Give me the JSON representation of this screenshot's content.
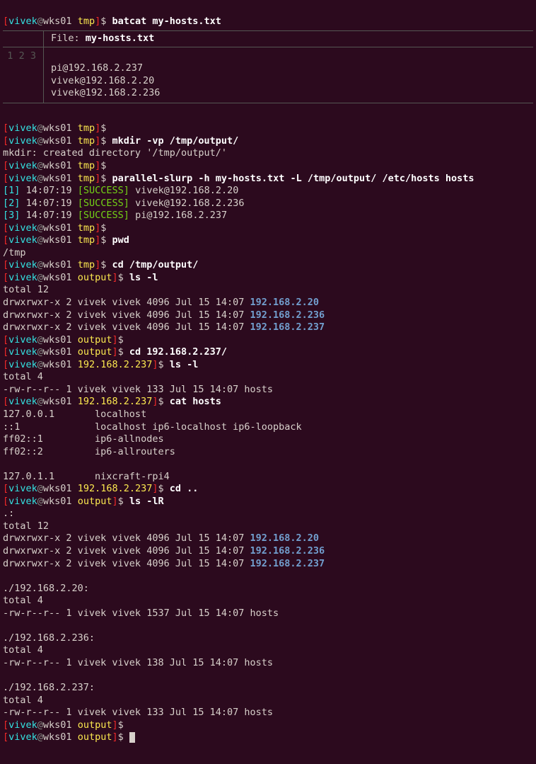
{
  "prompt": {
    "user": "vivek",
    "host": "wks01",
    "tmp": "tmp",
    "output": "output",
    "ip237": "192.168.2.237"
  },
  "cmd": {
    "batcat": "batcat my-hosts.txt",
    "mkdir": "mkdir -vp /tmp/output/",
    "pslurp": "parallel-slurp -h my-hosts.txt -L /tmp/output/ /etc/hosts hosts",
    "pwd": "pwd",
    "cdoutput": "cd /tmp/output/",
    "lsl": "ls -l",
    "cd237": "cd 192.168.2.237/",
    "cathosts": "cat hosts",
    "cdup": "cd ..",
    "lslr": "ls -lR"
  },
  "bat": {
    "file_label": "File:",
    "file_name": "my-hosts.txt",
    "ln1": "1",
    "ln2": "2",
    "ln3": "3",
    "l1": "pi@192.168.2.237",
    "l2": "vivek@192.168.2.20",
    "l3": "vivek@192.168.2.236"
  },
  "out": {
    "mkdir": "mkdir: created directory '/tmp/output/'",
    "pwd": "/tmp",
    "total12": "total 12",
    "total4": "total 4",
    "dotcolon": ".:",
    "dir20": "./192.168.2.20:",
    "dir236": "./192.168.2.236:",
    "dir237": "./192.168.2.237:"
  },
  "pssh": {
    "n1": "1",
    "n2": "2",
    "n3": "3",
    "t1": "14:07:19",
    "t2": "14:07:19",
    "t3": "14:07:19",
    "success": "SUCCESS",
    "h1": "vivek@192.168.2.20",
    "h2": "vivek@192.168.2.236",
    "h3": "pi@192.168.2.237"
  },
  "ls": {
    "row_prefix": "drwxrwxr-x 2 vivek vivek 4096 Jul 15 14:07 ",
    "ip20": "192.168.2.20",
    "ip236": "192.168.2.236",
    "ip237": "192.168.2.237",
    "hosts133": "-rw-r--r-- 1 vivek vivek 133 Jul 15 14:07 hosts",
    "hosts1537": "-rw-r--r-- 1 vivek vivek 1537 Jul 15 14:07 hosts",
    "hosts138": "-rw-r--r-- 1 vivek vivek 138 Jul 15 14:07 hosts"
  },
  "hosts": {
    "l1": "127.0.0.1       localhost",
    "l2": "::1             localhost ip6-localhost ip6-loopback",
    "l3": "ff02::1         ip6-allnodes",
    "l4": "ff02::2         ip6-allrouters",
    "l5": "127.0.1.1       nixcraft-rpi4"
  },
  "glyph": {
    "dollar": "$ ",
    "lbracket": "[",
    "rbracket": "]",
    "at": "@",
    "space": " "
  }
}
